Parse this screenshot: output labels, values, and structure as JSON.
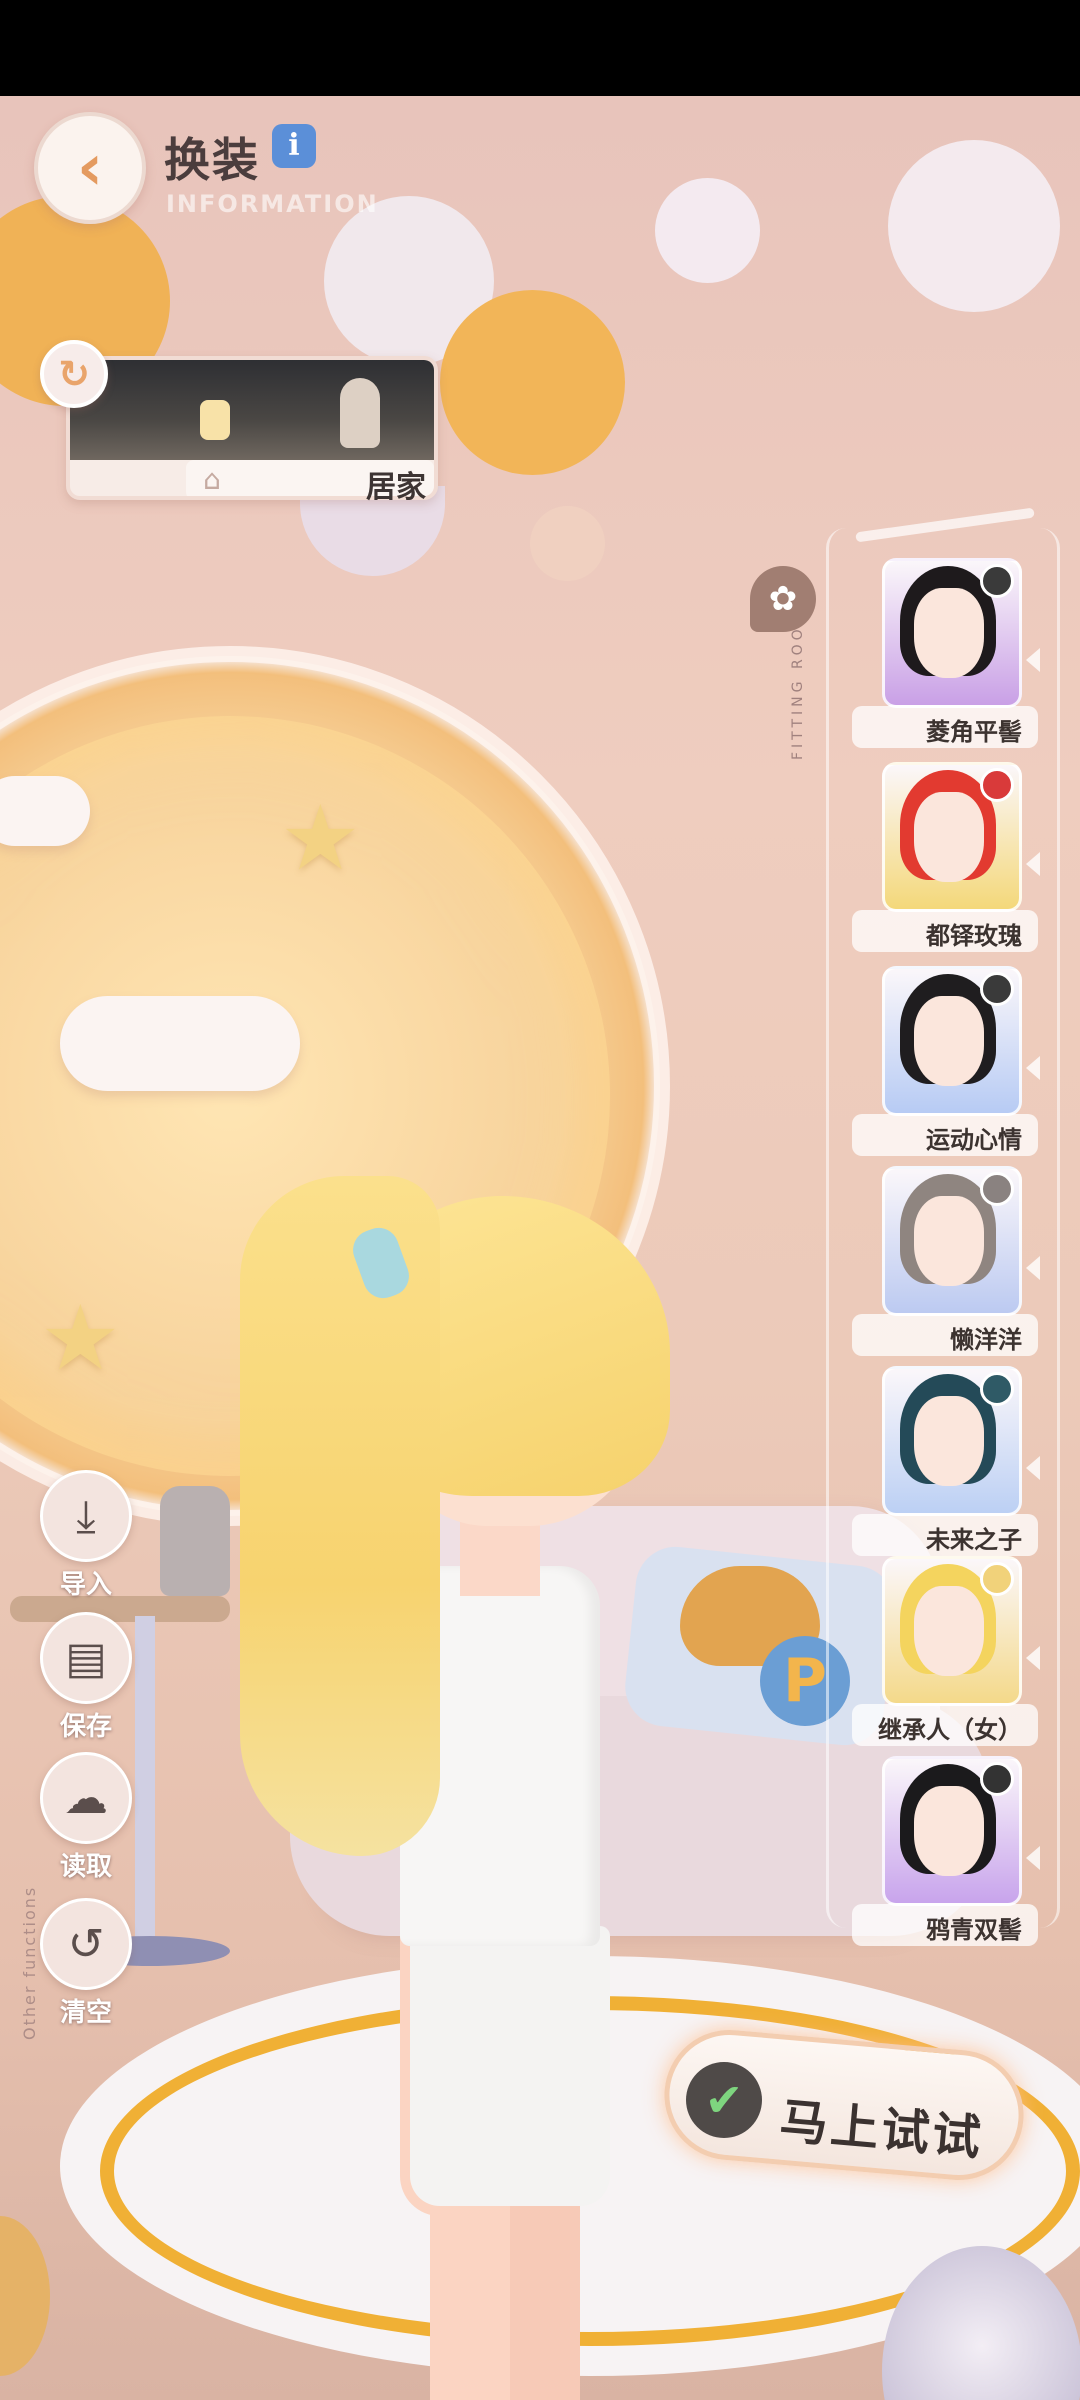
{
  "header": {
    "title": "换装",
    "subtitle": "INFORMATION",
    "back_icon": "back-arrow-icon",
    "info_icon": "info-icon",
    "info_glyph": "i"
  },
  "scene_card": {
    "label": "居家",
    "home_icon": "home-icon",
    "refresh_icon": "refresh-icon"
  },
  "panel": {
    "vertical_label": "FITTING ROOM",
    "flower_icon": "flower-icon",
    "hairstyles": [
      {
        "label": "菱角平髻",
        "card_color": "#c9a0e6",
        "hair_color": "#1e1a1c",
        "dot_color": "#3a3a3a"
      },
      {
        "label": "都铎玫瑰",
        "card_color": "#f4d87a",
        "hair_color": "#e23a30",
        "dot_color": "#d93a3a"
      },
      {
        "label": "运动心情",
        "card_color": "#b7cbf4",
        "hair_color": "#1f1d1f",
        "dot_color": "#3a3a3a"
      },
      {
        "label": "懒洋洋",
        "card_color": "#bccaf1",
        "hair_color": "#8f8580",
        "dot_color": "#8a8280"
      },
      {
        "label": "未来之子",
        "card_color": "#bcd0f4",
        "hair_color": "#244a58",
        "dot_color": "#2f5a66"
      },
      {
        "label": "继承人（女）",
        "card_color": "#f4d98a",
        "hair_color": "#f4d45e",
        "dot_color": "#f1d27a"
      },
      {
        "label": "鸦青双髻",
        "card_color": "#c8a4ec",
        "hair_color": "#1b1a1c",
        "dot_color": "#333333"
      }
    ]
  },
  "functions": {
    "import_label": "导入",
    "save_label": "保存",
    "load_label": "读取",
    "clear_label": "清空",
    "side_label": "Other functions",
    "import_icon": "import-icon",
    "save_icon": "save-icon",
    "load_icon": "load-icon",
    "clear_icon": "clear-icon"
  },
  "try_button": {
    "label": "马上试试",
    "check_icon": "check-icon"
  },
  "colors": {
    "accent": "#e9a46b",
    "gold": "#f0b035",
    "background": "#e9c6b6"
  }
}
